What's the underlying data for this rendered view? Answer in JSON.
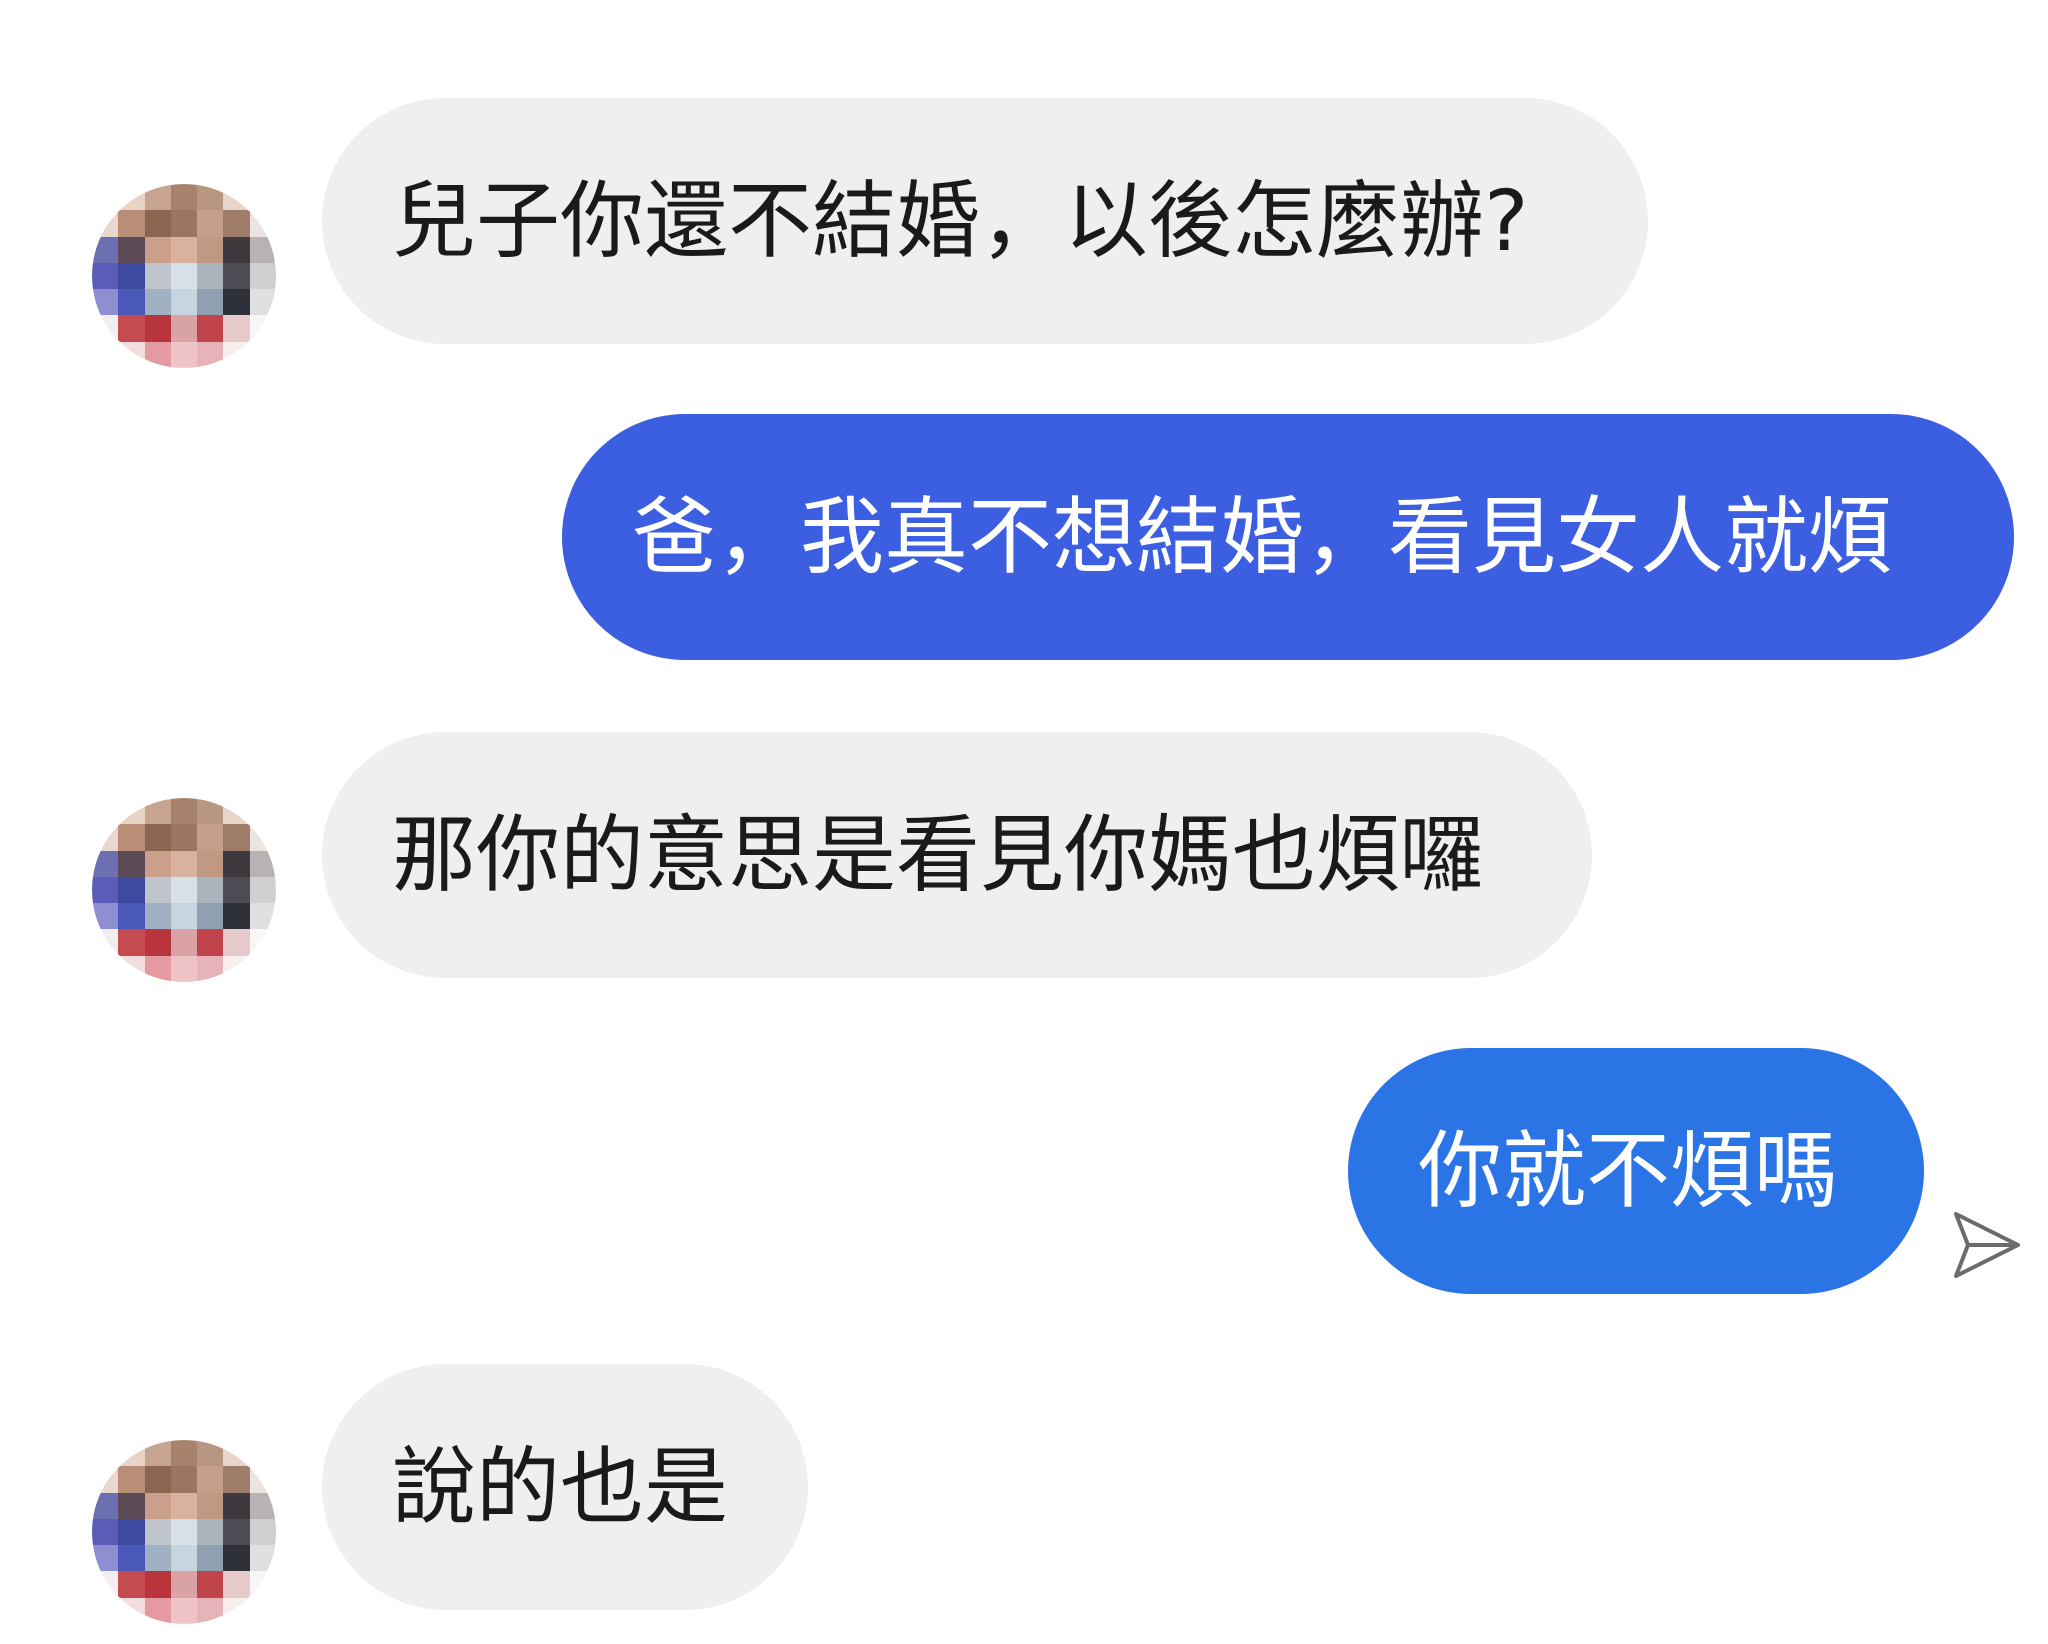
{
  "colors": {
    "incoming_bubble": "#efefef",
    "outgoing_bubble_1": "#3b5fe0",
    "outgoing_bubble_2": "#2a74e6",
    "incoming_text": "#1a1a1a",
    "outgoing_text": "#ffffff"
  },
  "messages": [
    {
      "direction": "incoming",
      "text": "兒子你還不結婚，以後怎麼辦?"
    },
    {
      "direction": "outgoing",
      "text": "爸，我真不想結婚，看見女人就煩"
    },
    {
      "direction": "incoming",
      "text": "那你的意思是看見你媽也煩囉"
    },
    {
      "direction": "outgoing",
      "text": "你就不煩嗎"
    },
    {
      "direction": "incoming",
      "text": "說的也是"
    }
  ],
  "icons": {
    "avatar": "pixelated-avatar",
    "sent_status": "sent-icon"
  }
}
